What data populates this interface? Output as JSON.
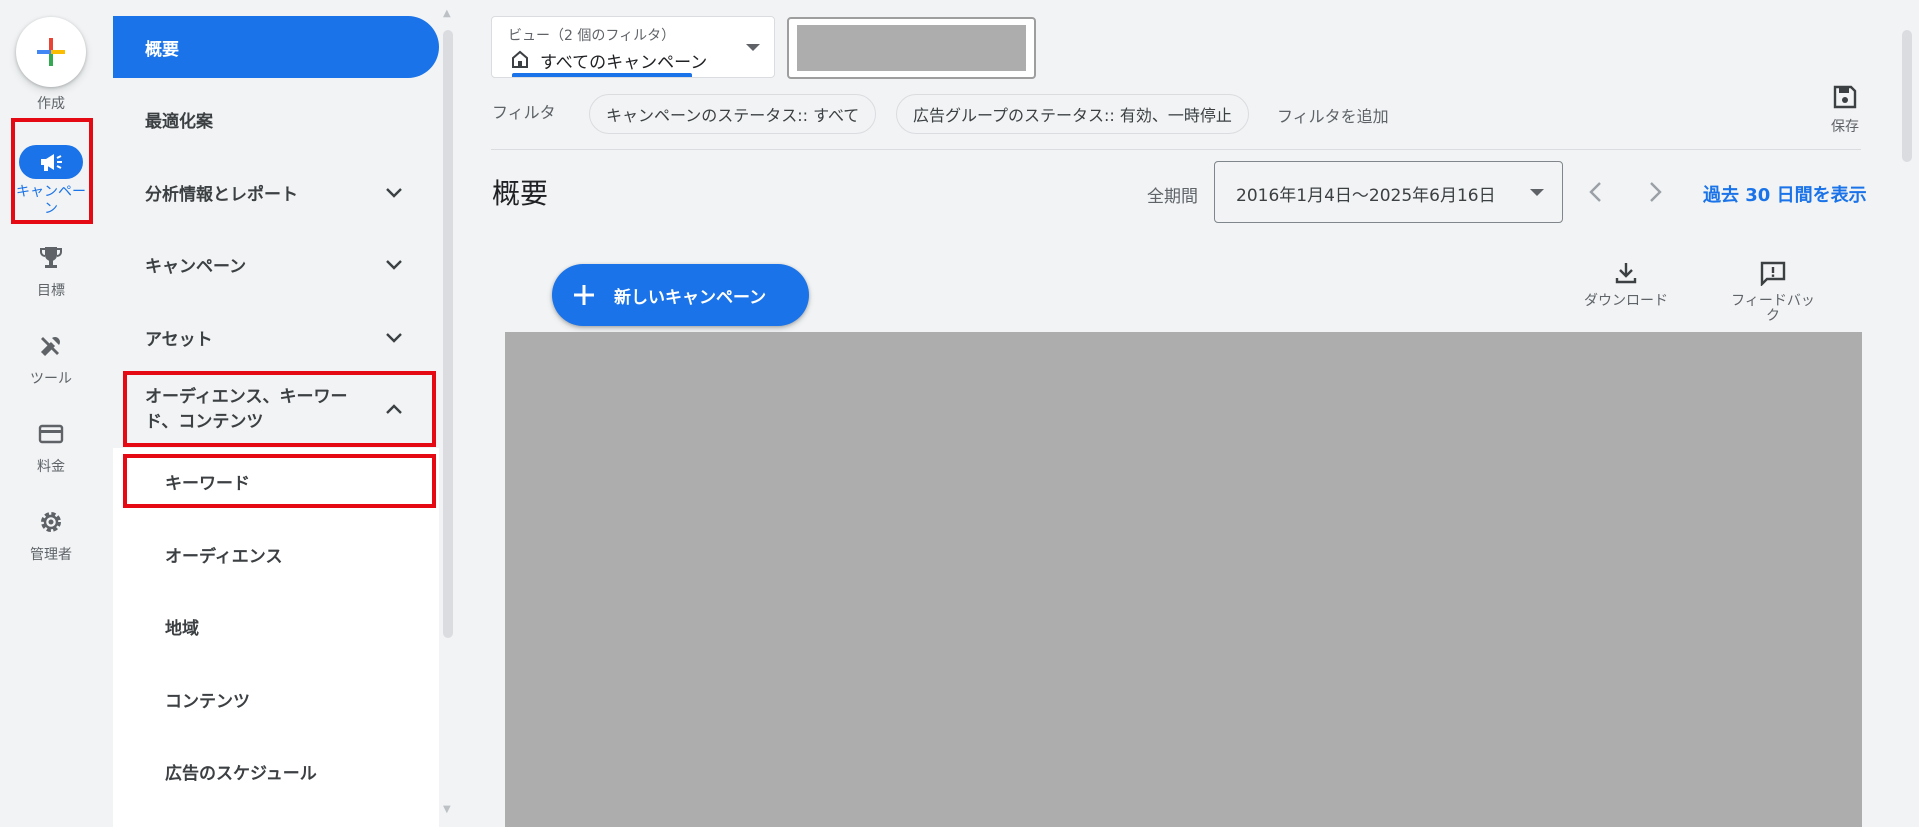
{
  "rail": {
    "create_label": "作成",
    "campaign_label": "キャンペーン",
    "goals_label": "目標",
    "tools_label": "ツール",
    "billing_label": "料金",
    "admin_label": "管理者"
  },
  "nav": {
    "overview": "概要",
    "recommendations": "最適化案",
    "insights": "分析情報とレポート",
    "campaigns": "キャンペーン",
    "assets": "アセット",
    "audiences": "オーディエンス、キーワード、コンテンツ",
    "keywords": "キーワード",
    "audience": "オーディエンス",
    "location": "地域",
    "content": "コンテンツ",
    "ad_schedule": "広告のスケジュール"
  },
  "view": {
    "caption": "ビュー（2 個のフィルタ）",
    "value": "すべてのキャンペーン"
  },
  "filters": {
    "label": "フィルタ",
    "chips": [
      "キャンペーンのステータス:: すべて",
      "広告グループのステータス:: 有効、一時停止"
    ],
    "add_filter": "フィルタを追加",
    "save": "保存"
  },
  "header": {
    "title": "概要",
    "period_label": "全期間",
    "date_range": "2016年1月4日～2025年6月16日",
    "last30": "過去 30 日間を表示"
  },
  "toolbar": {
    "new_campaign": "新しいキャンペーン",
    "download": "ダウンロード",
    "feedback": "フィードバック"
  },
  "colors": {
    "accent": "#1a73e8",
    "highlight": "#e50914",
    "placeholder": "#adadad"
  }
}
